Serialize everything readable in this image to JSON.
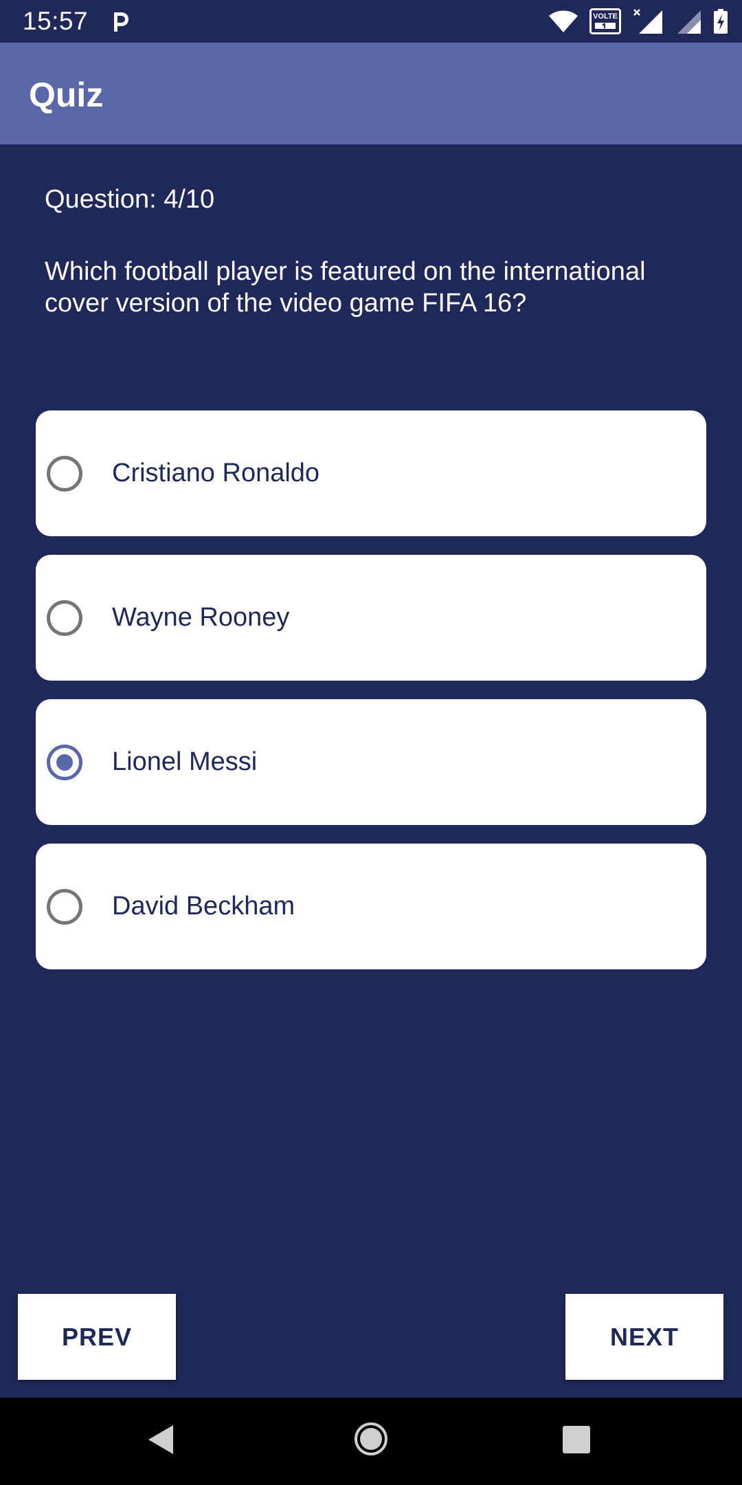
{
  "status_bar": {
    "time": "15:57",
    "volte_label": "VOLTE"
  },
  "app_bar": {
    "title": "Quiz"
  },
  "quiz": {
    "counter": "Question: 4/10",
    "question": "Which football player is featured on the international cover version of the video game FIFA 16?",
    "options": [
      {
        "label": "Cristiano Ronaldo",
        "selected": false
      },
      {
        "label": "Wayne Rooney",
        "selected": false
      },
      {
        "label": "Lionel Messi",
        "selected": true
      },
      {
        "label": "David Beckham",
        "selected": false
      }
    ]
  },
  "navigation": {
    "prev_label": "PREV",
    "next_label": "NEXT"
  },
  "colors": {
    "background": "#20285a",
    "accent": "#5a67a8",
    "card": "#ffffff"
  }
}
